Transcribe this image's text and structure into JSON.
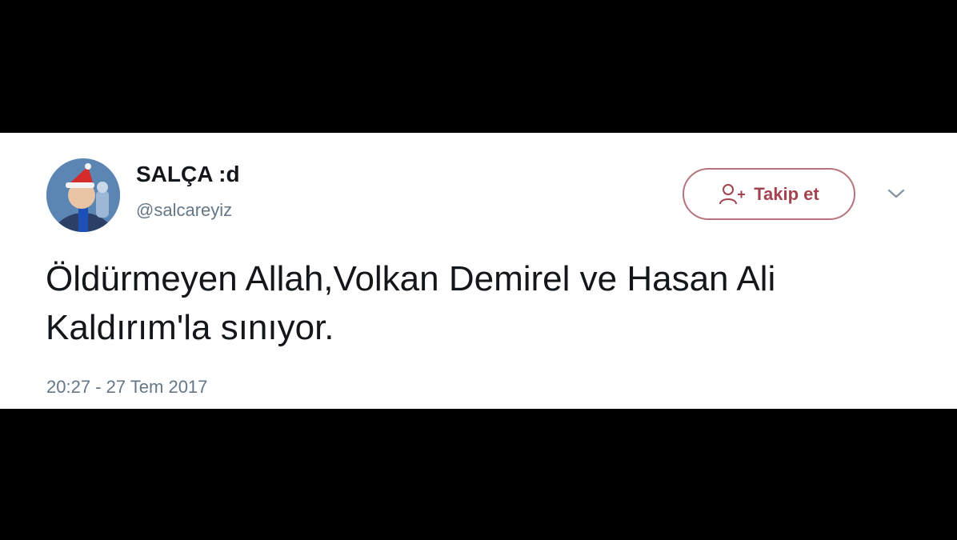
{
  "tweet": {
    "display_name": "SALÇA :d",
    "handle": "@salcareyiz",
    "text": "Öldürmeyen Allah,Volkan Demirel ve Hasan Ali Kaldırım'la sınıyor.",
    "timestamp": "20:27 - 27 Tem 2017",
    "avatar_icon": "profile-avatar-santa-hat"
  },
  "follow_button": {
    "label": "Takip et",
    "icon": "add-user-icon",
    "color": "#a2434f"
  },
  "menu": {
    "icon": "chevron-down-icon"
  },
  "colors": {
    "background": "#000000",
    "card": "#ffffff",
    "text": "#14171a",
    "secondary": "#657786"
  }
}
